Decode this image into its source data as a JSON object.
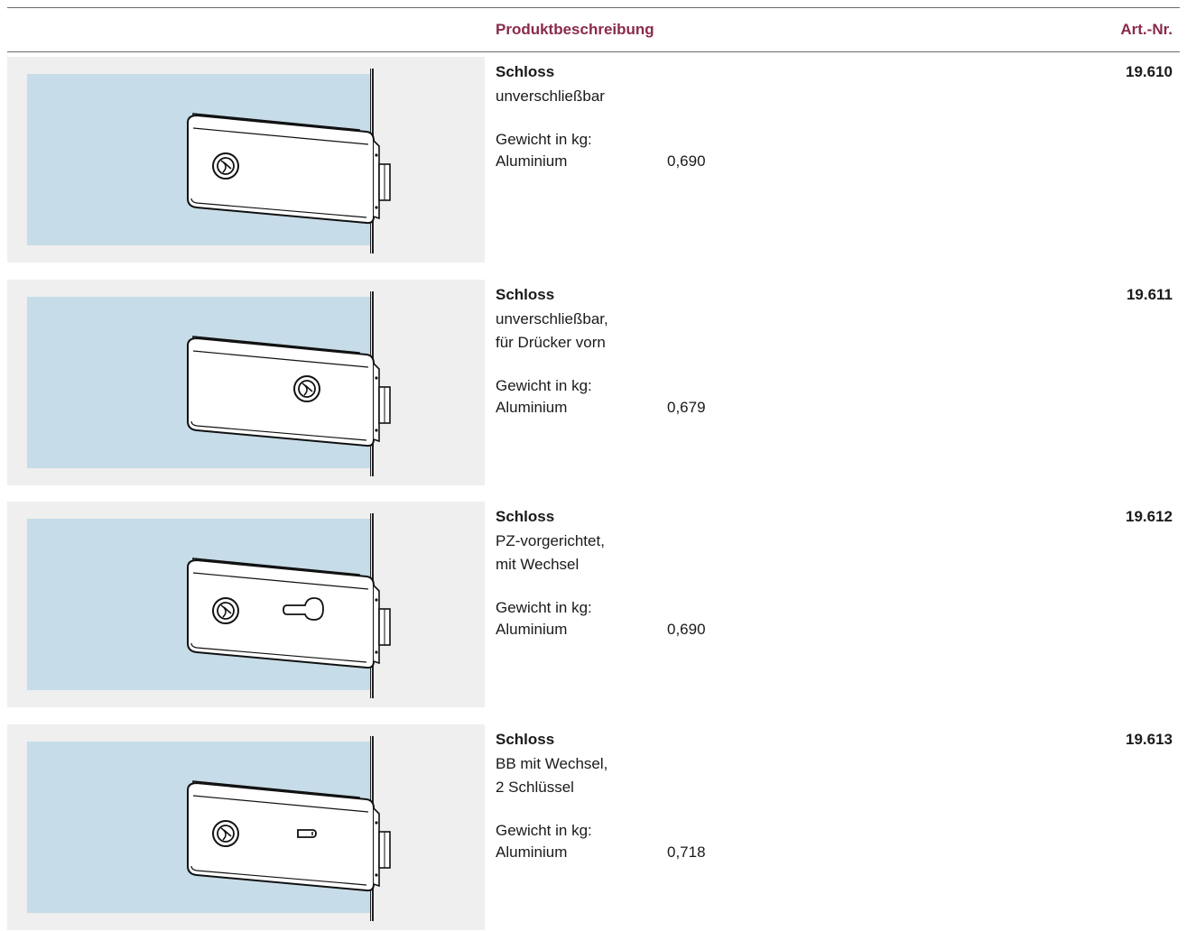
{
  "header": {
    "col_description": "Produktbeschreibung",
    "col_article": "Art.-Nr."
  },
  "products": [
    {
      "name": "Schloss",
      "desc_lines": [
        "unverschließbar"
      ],
      "weight_label": "Gewicht in kg:",
      "material": "Aluminium",
      "weight": "0,690",
      "article": "19.610",
      "variant": "plain-left"
    },
    {
      "name": "Schloss",
      "desc_lines": [
        "unverschließbar,",
        "für Drücker vorn"
      ],
      "weight_label": "Gewicht in kg:",
      "material": "Aluminium",
      "weight": "0,679",
      "article": "19.611",
      "variant": "plain-right"
    },
    {
      "name": "Schloss",
      "desc_lines": [
        "PZ-vorgerichtet,",
        "mit Wechsel"
      ],
      "weight_label": "Gewicht in kg:",
      "material": "Aluminium",
      "weight": "0,690",
      "article": "19.612",
      "variant": "profile-cylinder"
    },
    {
      "name": "Schloss",
      "desc_lines": [
        "BB mit Wechsel,",
        "2 Schlüssel"
      ],
      "weight_label": "Gewicht in kg:",
      "material": "Aluminium",
      "weight": "0,718",
      "article": "19.613",
      "variant": "bit-key"
    }
  ],
  "colors": {
    "header_accent": "#8a2a4a",
    "glass": "#c6dce8",
    "panel": "#efefef"
  }
}
